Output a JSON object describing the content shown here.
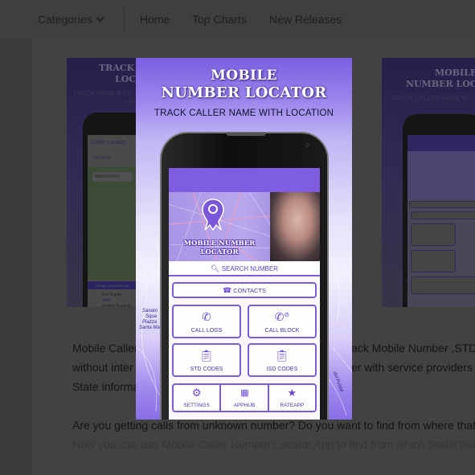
{
  "nav": {
    "categories_label": "Categories",
    "items": [
      "Home",
      "Top Charts",
      "New Releases"
    ]
  },
  "screenshots": {
    "left": {
      "title_line1": "TRACK",
      "title_line2": "LOC",
      "subtitle": "TRACK NAME & LO",
      "subtitle2": "ON",
      "app_title": "Caller Locator",
      "tab": "LOCATOR",
      "number_field": "99652XXXXX",
      "show_location": "SHOW LOCATION ON",
      "result_name": "Anil Kumar",
      "result_op": "Airtel",
      "result_state": "Andhra Pradesh"
    },
    "right": {
      "title_line1": "MOBILE",
      "title_line2": "NUMBER LOC",
      "subtitle": "TRACK CALLER NAME W"
    }
  },
  "lightbox": {
    "title_line1": "MOBILE",
    "title_line2": "NUMBER LOCATOR",
    "subtitle": "TRACK CALLER NAME WITH LOCATION",
    "banner_title_line1": "MOBILE NUMBER",
    "banner_title_line2": "LOCATOR",
    "search_label": "SEARCH NUMBER",
    "contacts_label": "CONTACTS",
    "grid_buttons": [
      {
        "label": "CALL LOGS",
        "icon": "phone-log-icon"
      },
      {
        "label": "CALL BLOCK",
        "icon": "phone-block-icon"
      },
      {
        "label": "STD CODES",
        "icon": "clipboard-icon"
      },
      {
        "label": "ISD CODES",
        "icon": "clipboard-icon"
      }
    ],
    "bottom_buttons": [
      {
        "label": "SETTINGS",
        "icon": "gear-icon"
      },
      {
        "label": "APPHUB",
        "icon": "grid-icon"
      },
      {
        "label": "RATEAPP",
        "icon": "star-icon"
      }
    ],
    "map_labels": [
      "Sanato",
      "Squa",
      "Piazza",
      "Santa Ma",
      "del Pubbli"
    ],
    "accent": "#7f5de0"
  },
  "description": {
    "line1_left": "Mobile Caller",
    "line1_right": "ack Mobile Number ,STD",
    "line2_left": "without inter",
    "line2_right": "er with service providers",
    "line3_left": "State informa",
    "para2": "Are you getting calls from unknown number? Do you want to find from where that",
    "para3": "Now you can use Mobile Caller Number Locator App to find from which State/Tele"
  }
}
